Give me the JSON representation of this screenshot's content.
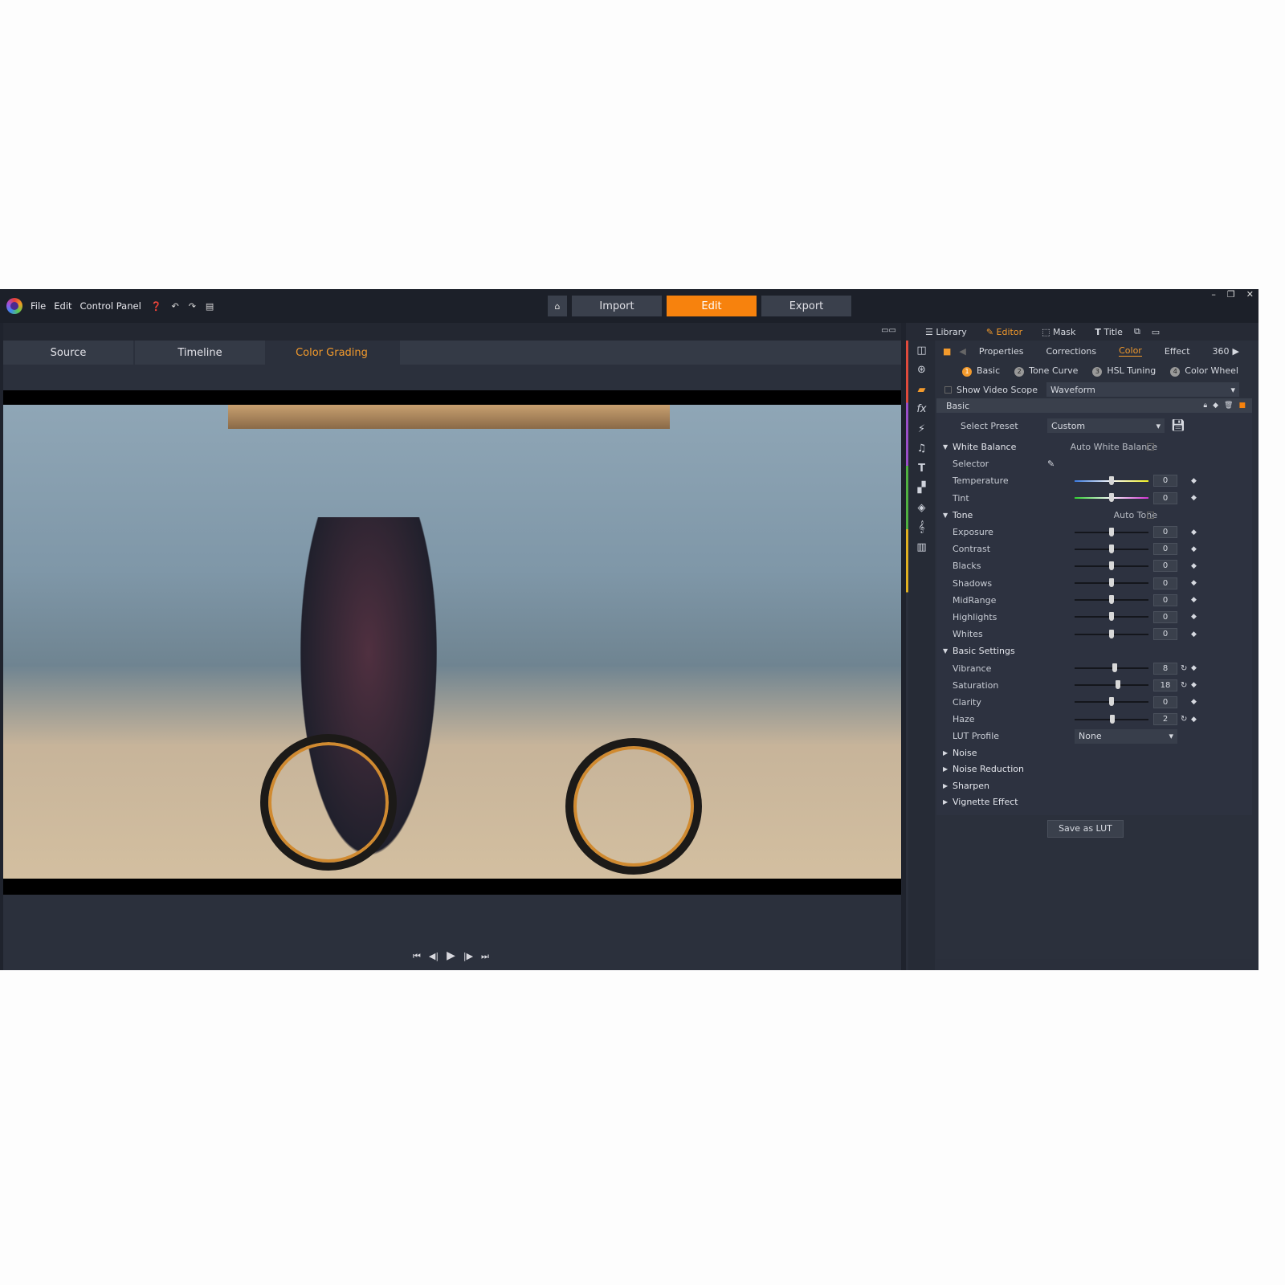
{
  "menu": {
    "items": [
      "File",
      "Edit",
      "Control Panel"
    ]
  },
  "modes": {
    "import": "Import",
    "edit": "Edit",
    "export": "Export",
    "active": "Edit"
  },
  "left_tabs": [
    {
      "label": "Source"
    },
    {
      "label": "Timeline"
    },
    {
      "label": "Color Grading",
      "active": true
    }
  ],
  "right_tabs": {
    "library": "Library",
    "editor": "Editor",
    "mask": "Mask",
    "title": "Title"
  },
  "category_tabs": {
    "properties": "Properties",
    "corrections": "Corrections",
    "color": "Color",
    "effect": "Effect",
    "more": "360"
  },
  "steps": [
    {
      "n": "1",
      "label": "Basic"
    },
    {
      "n": "2",
      "label": "Tone Curve"
    },
    {
      "n": "3",
      "label": "HSL Tuning"
    },
    {
      "n": "4",
      "label": "Color Wheel"
    }
  ],
  "scope": {
    "label": "Show Video Scope",
    "value": "Waveform",
    "checked": false
  },
  "section": {
    "title": "Basic"
  },
  "preset": {
    "label": "Select Preset",
    "value": "Custom"
  },
  "white_balance": {
    "label": "White Balance",
    "auto_label": "Auto White Balance",
    "selector": "Selector",
    "sliders": [
      {
        "label": "Temperature",
        "value": 0,
        "gradient": "linear-gradient(90deg,#3a7ae0,#fff,#f0f020)"
      },
      {
        "label": "Tint",
        "value": 0,
        "gradient": "linear-gradient(90deg,#30d030,#fff,#d030d0)"
      }
    ]
  },
  "tone": {
    "label": "Tone",
    "auto_label": "Auto Tone",
    "sliders": [
      {
        "label": "Exposure",
        "value": 0
      },
      {
        "label": "Contrast",
        "value": 0
      },
      {
        "label": "Blacks",
        "value": 0
      },
      {
        "label": "Shadows",
        "value": 0
      },
      {
        "label": "MidRange",
        "value": 0
      },
      {
        "label": "Highlights",
        "value": 0
      },
      {
        "label": "Whites",
        "value": 0
      }
    ]
  },
  "basic_settings": {
    "label": "Basic Settings",
    "sliders": [
      {
        "label": "Vibrance",
        "value": 8,
        "modified": true
      },
      {
        "label": "Saturation",
        "value": 18,
        "modified": true
      },
      {
        "label": "Clarity",
        "value": 0
      },
      {
        "label": "Haze",
        "value": 2,
        "modified": true
      }
    ],
    "lut_label": "LUT Profile",
    "lut_value": "None"
  },
  "collapsed": [
    "Noise",
    "Noise Reduction",
    "Sharpen",
    "Vignette Effect"
  ],
  "save_lut": "Save as LUT",
  "colors": {
    "accent": "#f7820d",
    "background": "#1f232d"
  }
}
